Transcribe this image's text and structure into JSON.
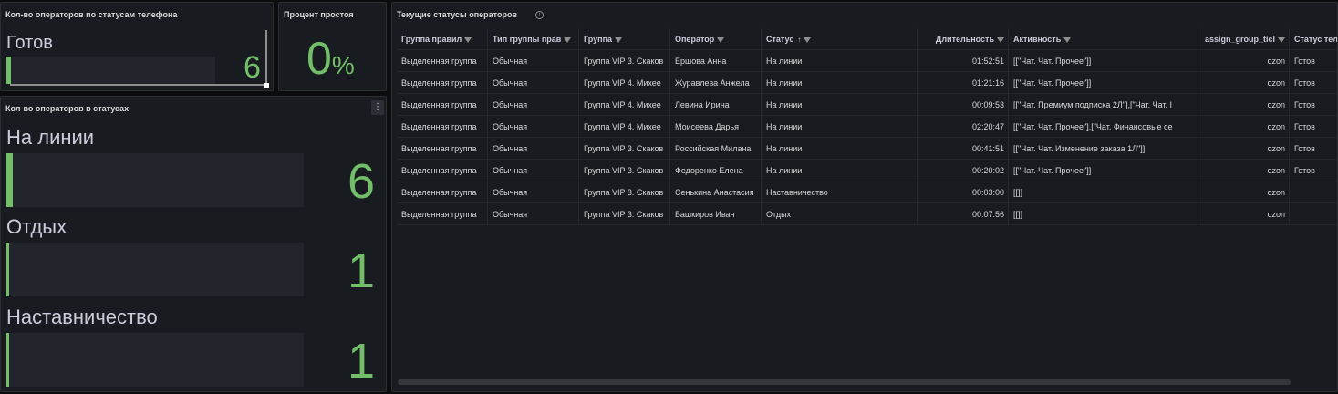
{
  "colors": {
    "accent": "#73bf69",
    "panel_bg": "#181b1f",
    "bar_bg": "#22252b"
  },
  "phone_panel": {
    "title": "Кол-во операторов по статусам телефона",
    "label": "Готов",
    "value": "6",
    "fill_fraction": 0.02
  },
  "idle_panel": {
    "title": "Процент простоя",
    "value": "0",
    "unit": "%"
  },
  "status_panel": {
    "title": "Кол-во операторов в статусах",
    "menu_icon": "kebab-icon",
    "items": [
      {
        "label": "На линии",
        "value": "6",
        "fill_fraction": 0.02
      },
      {
        "label": "Отдых",
        "value": "1",
        "fill_fraction": 0.005
      },
      {
        "label": "Наставничество",
        "value": "1",
        "fill_fraction": 0.005
      }
    ]
  },
  "table_panel": {
    "title": "Текущие статусы операторов",
    "info_icon": "info-icon",
    "columns": [
      {
        "label": "Группа правил",
        "filter": true
      },
      {
        "label": "Тип группы прав",
        "filter": true
      },
      {
        "label": "Группа",
        "filter": true
      },
      {
        "label": "Оператор",
        "filter": true
      },
      {
        "label": "Статус",
        "filter": true,
        "sort": "↑"
      },
      {
        "label": "Длительность",
        "filter": true
      },
      {
        "label": "Активность",
        "filter": true
      },
      {
        "label": "assign_group_ticl",
        "filter": true
      },
      {
        "label": "Статус теле",
        "filter": false
      }
    ],
    "rows": [
      [
        "Выделенная группа",
        "Обычная",
        "Группа VIP 3. Скаков",
        "Ершова Анна",
        "На линии",
        "01:52:51",
        "[[\"Чат. Чат. Прочее\"]]",
        "ozon",
        "Готов"
      ],
      [
        "Выделенная группа",
        "Обычная",
        "Группа VIP 4. Михее",
        "Журавлева Анжела",
        "На линии",
        "01:21:16",
        "[[\"Чат. Чат. Прочее\"]]",
        "ozon",
        "Готов"
      ],
      [
        "Выделенная группа",
        "Обычная",
        "Группа VIP 4. Михее",
        "Левина Ирина",
        "На линии",
        "00:09:53",
        "[[\"Чат. Премиум подписка 2Л\"],[\"Чат. Чат. I",
        "ozon",
        "Готов"
      ],
      [
        "Выделенная группа",
        "Обычная",
        "Группа VIP 4. Михее",
        "Моисеева Дарья",
        "На линии",
        "02:20:47",
        "[[\"Чат. Чат. Прочее\"],[\"Чат. Финансовые се",
        "ozon",
        "Готов"
      ],
      [
        "Выделенная группа",
        "Обычная",
        "Группа VIP 3. Скаков",
        "Российская Милана",
        "На линии",
        "00:41:51",
        "[[\"Чат. Чат. Изменение заказа 1Л\"]]",
        "ozon",
        "Готов"
      ],
      [
        "Выделенная группа",
        "Обычная",
        "Группа VIP 3. Скаков",
        "Федоренко Елена",
        "На линии",
        "00:20:02",
        "[[\"Чат. Чат. Прочее\"]]",
        "ozon",
        "Готов"
      ],
      [
        "Выделенная группа",
        "Обычная",
        "Группа VIP 3. Скаков",
        "Сенькина Анастасия",
        "Наставничество",
        "00:03:00",
        "[[]]",
        "ozon",
        ""
      ],
      [
        "Выделенная группа",
        "Обычная",
        "Группа VIP 3. Скаков",
        "Башкиров Иван",
        "Отдых",
        "00:07:56",
        "[[]]",
        "ozon",
        ""
      ]
    ]
  }
}
